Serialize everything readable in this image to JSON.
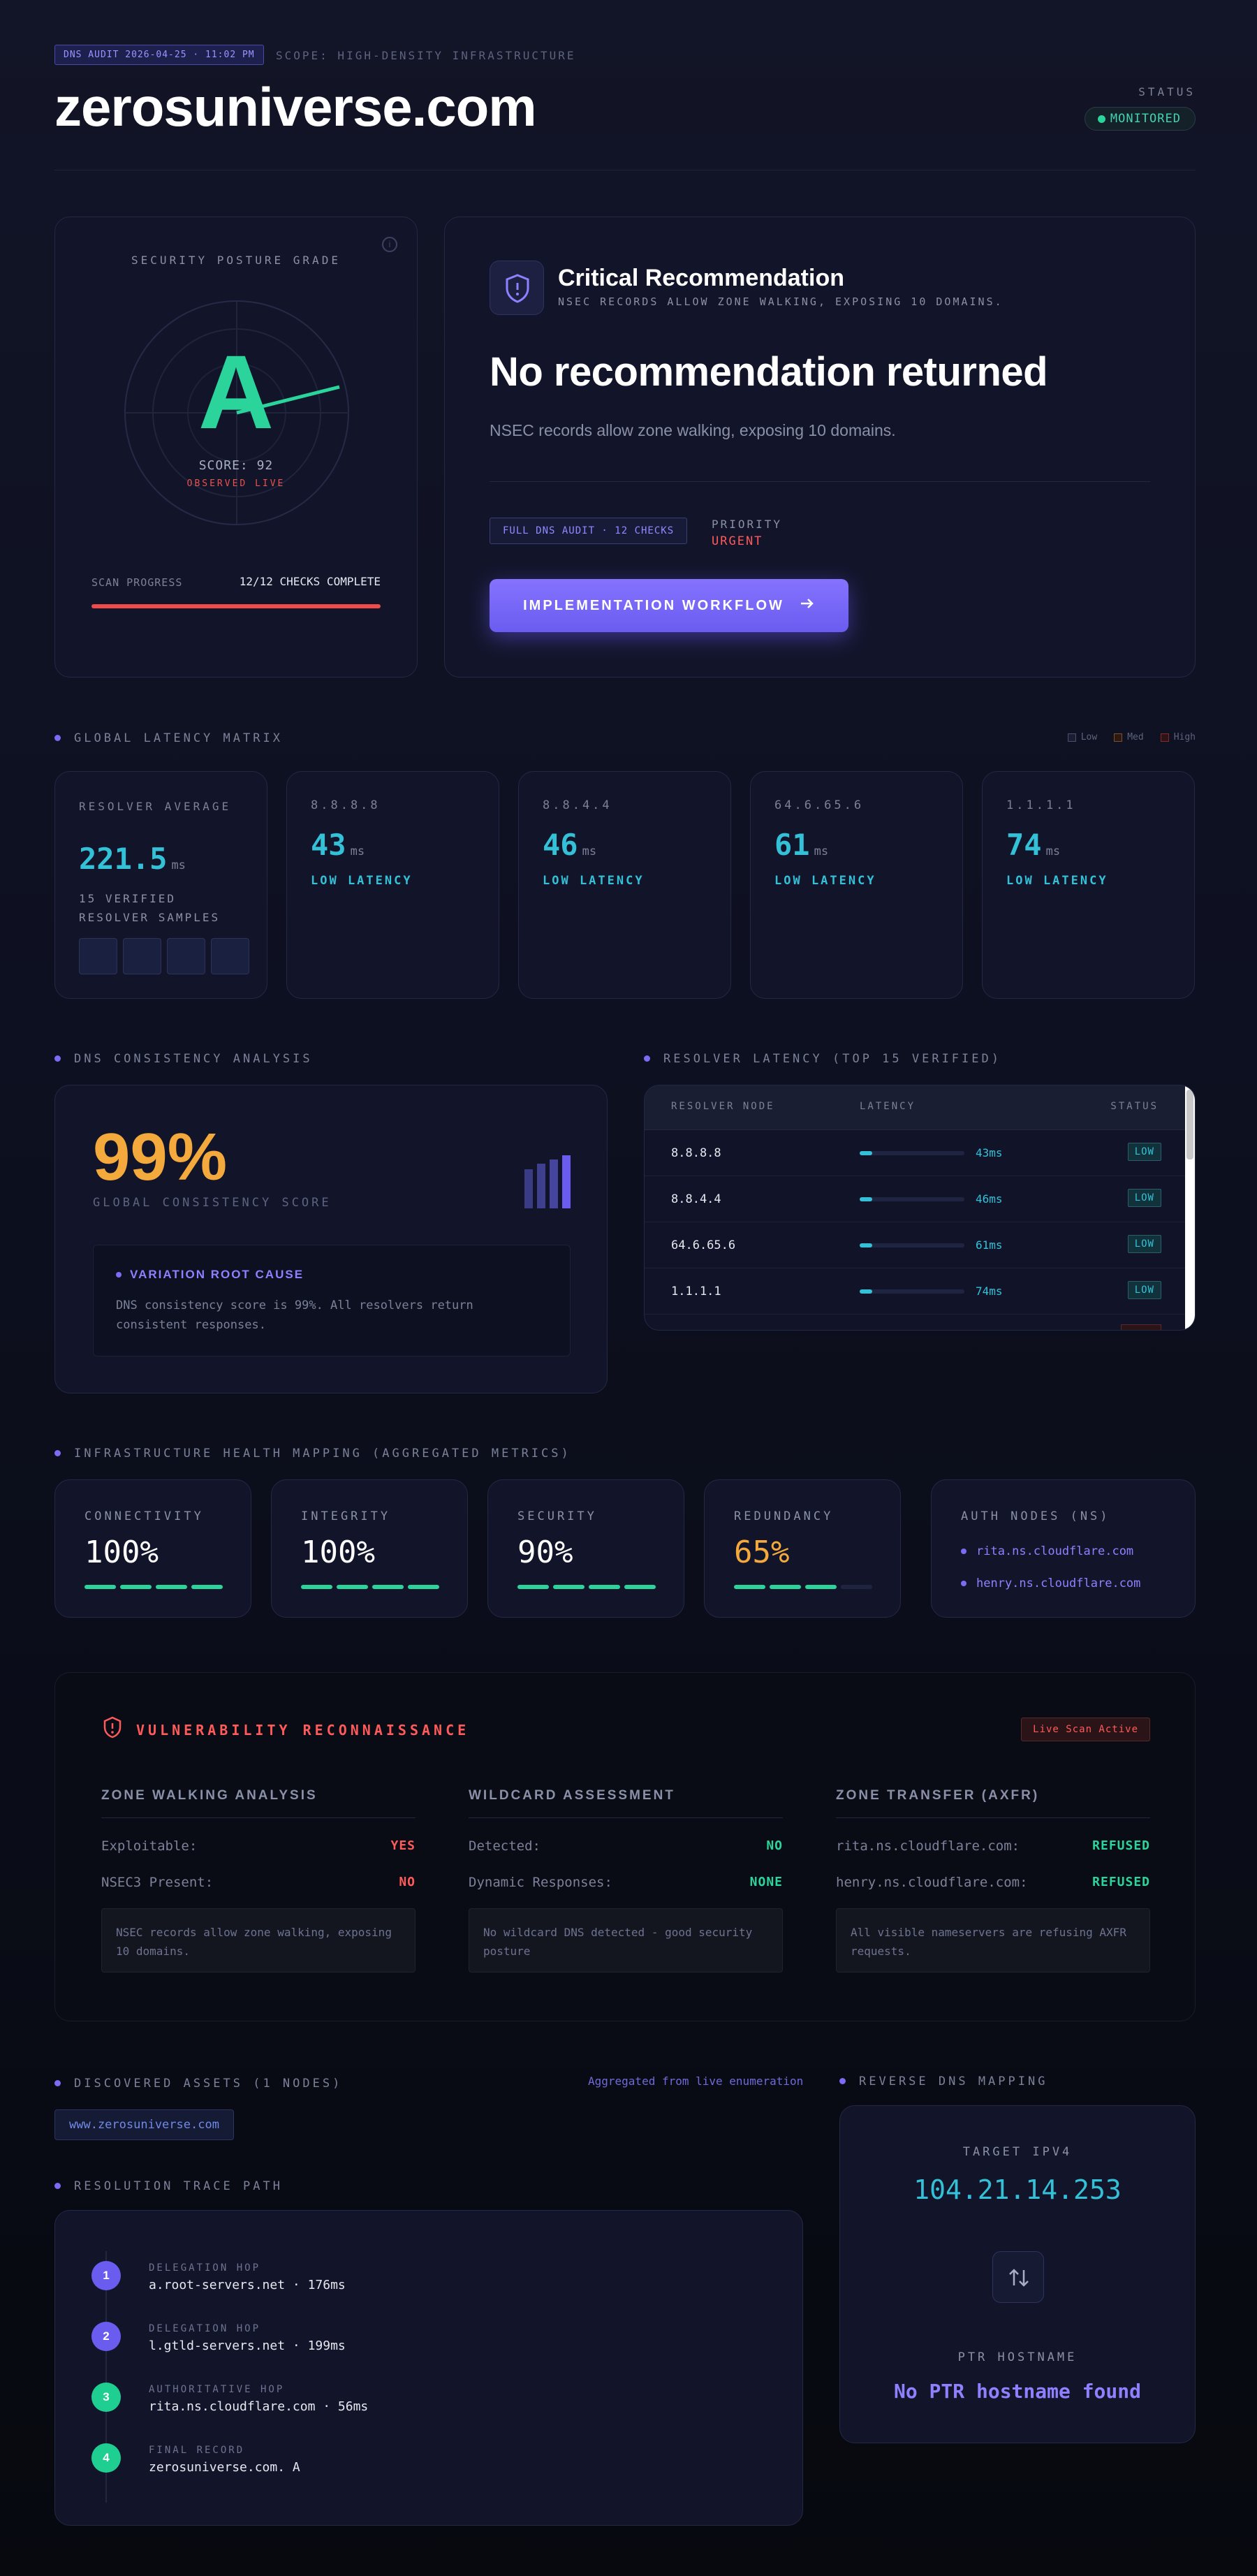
{
  "header": {
    "audit_tag": "DNS AUDIT 2026-04-25 · 11:02 PM",
    "scope": "SCOPE: HIGH-DENSITY INFRASTRUCTURE",
    "domain": "zerosuniverse.com",
    "status_label": "STATUS",
    "status_value": "MONITORED"
  },
  "grade": {
    "title": "SECURITY POSTURE GRADE",
    "letter": "A",
    "score": "SCORE: 92",
    "observed": "OBSERVED LIVE",
    "progress_label": "SCAN PROGRESS",
    "progress_value": "12/12 CHECKS COMPLETE",
    "progress_fraction": 1.0
  },
  "recommendation": {
    "title": "Critical Recommendation",
    "subtitle": "NSEC RECORDS ALLOW ZONE WALKING, EXPOSING 10 DOMAINS.",
    "headline": "No recommendation returned",
    "description": "NSEC records allow zone walking, exposing 10 domains.",
    "audit_chip": "FULL DNS AUDIT · 12 CHECKS",
    "priority_label": "PRIORITY",
    "priority_value": "URGENT",
    "button_label": "IMPLEMENTATION WORKFLOW"
  },
  "latency": {
    "section_title": "GLOBAL LATENCY MATRIX",
    "legend": [
      "Low",
      "Med",
      "High"
    ],
    "average_title": "RESOLVER AVERAGE",
    "average_value": "221.5",
    "unit": "ms",
    "samples": "15 VERIFIED RESOLVER SAMPLES",
    "resolvers": [
      {
        "ip": "8.8.8.8",
        "value": "43",
        "status": "LOW LATENCY"
      },
      {
        "ip": "8.8.4.4",
        "value": "46",
        "status": "LOW LATENCY"
      },
      {
        "ip": "64.6.65.6",
        "value": "61",
        "status": "LOW LATENCY"
      },
      {
        "ip": "1.1.1.1",
        "value": "74",
        "status": "LOW LATENCY"
      }
    ]
  },
  "consistency": {
    "section_title": "DNS CONSISTENCY ANALYSIS",
    "value": "99%",
    "label": "GLOBAL CONSISTENCY SCORE",
    "cause_title": "VARIATION ROOT CAUSE",
    "cause_text": "DNS consistency score is 99%. All resolvers return consistent responses."
  },
  "resolver_table": {
    "section_title": "RESOLVER LATENCY (TOP 15 VERIFIED)",
    "headers": [
      "RESOLVER NODE",
      "LATENCY",
      "STATUS"
    ],
    "rows": [
      {
        "node": "8.8.8.8",
        "latency": "43ms",
        "status": "LOW",
        "fill": 0.12
      },
      {
        "node": "8.8.4.4",
        "latency": "46ms",
        "status": "LOW",
        "fill": 0.12
      },
      {
        "node": "64.6.65.6",
        "latency": "61ms",
        "status": "LOW",
        "fill": 0.12
      },
      {
        "node": "1.1.1.1",
        "latency": "74ms",
        "status": "LOW",
        "fill": 0.12
      }
    ]
  },
  "health": {
    "section_title": "INFRASTRUCTURE HEALTH MAPPING (AGGREGATED METRICS)",
    "metrics": [
      {
        "name": "CONNECTIVITY",
        "value": "100%",
        "level": 4,
        "color": "#ffffff"
      },
      {
        "name": "INTEGRITY",
        "value": "100%",
        "level": 4,
        "color": "#ffffff"
      },
      {
        "name": "SECURITY",
        "value": "90%",
        "level": 4,
        "color": "#ffffff"
      },
      {
        "name": "REDUNDANCY",
        "value": "65%",
        "level": 3,
        "color": "#f4a93c"
      }
    ],
    "auth_title": "AUTH NODES (NS)",
    "auth_nodes": [
      "rita.ns.cloudflare.com",
      "henry.ns.cloudflare.com"
    ]
  },
  "vulnerability": {
    "title": "VULNERABILITY RECONNAISSANCE",
    "live_badge": "Live Scan Active",
    "columns": [
      {
        "title": "ZONE WALKING ANALYSIS",
        "rows": [
          {
            "k": "Exploitable:",
            "v": "YES",
            "color": "#ff5a5a"
          },
          {
            "k": "NSEC3 Present:",
            "v": "NO",
            "color": "#ff5a5a"
          }
        ],
        "note": "NSEC records allow zone walking, exposing 10 domains."
      },
      {
        "title": "WILDCARD ASSESSMENT",
        "rows": [
          {
            "k": "Detected:",
            "v": "NO",
            "color": "#2ad49a"
          },
          {
            "k": "Dynamic Responses:",
            "v": "NONE",
            "color": "#2ad49a"
          }
        ],
        "note": "No wildcard DNS detected - good security posture"
      },
      {
        "title": "ZONE TRANSFER (AXFR)",
        "rows": [
          {
            "k": "rita.ns.cloudflare.com:",
            "v": "REFUSED",
            "color": "#2ad49a"
          },
          {
            "k": "henry.ns.cloudflare.com:",
            "v": "REFUSED",
            "color": "#2ad49a"
          }
        ],
        "note": "All visible nameservers are refusing AXFR requests."
      }
    ]
  },
  "assets": {
    "section_title": "DISCOVERED ASSETS (1 NODES)",
    "aggregated": "Aggregated from live enumeration",
    "items": [
      "www.zerosuniverse.com"
    ]
  },
  "trace": {
    "section_title": "RESOLUTION TRACE PATH",
    "hops": [
      {
        "n": "1",
        "type": "DELEGATION HOP",
        "host": "a.root-servers.net · 176ms",
        "color": "#6b5cf0"
      },
      {
        "n": "2",
        "type": "DELEGATION HOP",
        "host": "l.gtld-servers.net · 199ms",
        "color": "#6b5cf0"
      },
      {
        "n": "3",
        "type": "AUTHORITATIVE HOP",
        "host": "rita.ns.cloudflare.com · 56ms",
        "color": "#1fcf91"
      },
      {
        "n": "4",
        "type": "FINAL RECORD",
        "host": "zerosuniverse.com. A",
        "color": "#1fcf91"
      }
    ]
  },
  "rdns": {
    "section_title": "REVERSE DNS MAPPING",
    "target_label": "TARGET IPV4",
    "target_ip": "104.21.14.253",
    "ptr_label": "PTR HOSTNAME",
    "ptr_value": "No PTR hostname found"
  }
}
